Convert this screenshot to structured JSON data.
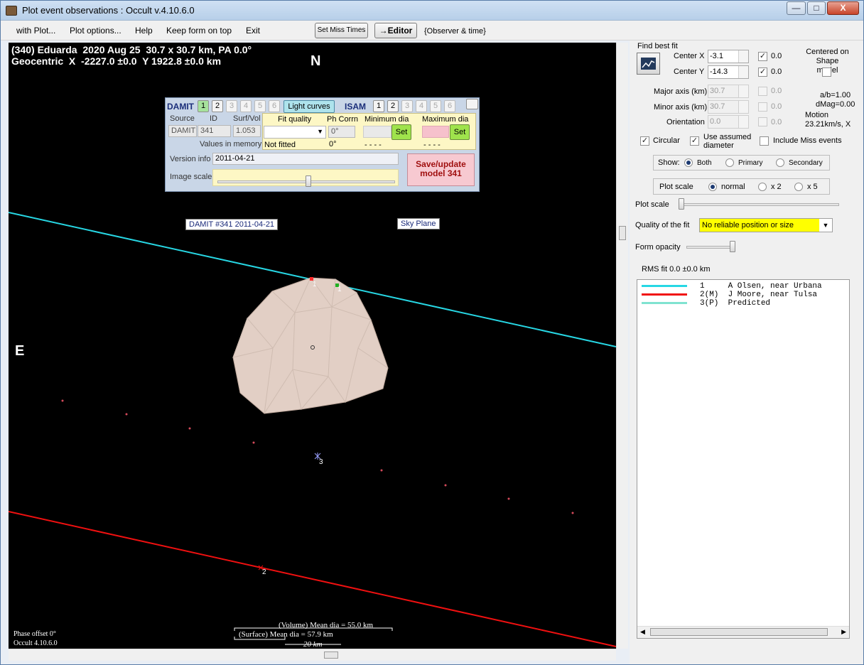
{
  "window": {
    "title": "Plot event observations : Occult v.4.10.6.0",
    "min_glyph": "—",
    "max_glyph": "□",
    "close_glyph": "X"
  },
  "menu": {
    "items": [
      "with Plot...",
      "Plot options...",
      "Help",
      "Keep form on top",
      "Exit"
    ],
    "set_miss_times": "Set Miss Times",
    "editor": "→Editor",
    "observer_time": "{Observer & time}"
  },
  "plot": {
    "header_line1": "(340) Eduarda  2020 Aug 25  30.7 x 30.7 km, PA 0.0°",
    "header_line2": "Geocentric  X  -2227.0 ±0.0  Y 1922.8 ±0.0 km",
    "north": "N",
    "east": "E",
    "model_label": "DAMIT #341 2011-04-21",
    "sky_plane_label": "Sky Plane",
    "chord_labels": [
      "1",
      "1",
      "2",
      "3"
    ],
    "volume_dia": "(Volume) Mean dia = 55.0 km",
    "surface_dia": "(Surface) Mean dia = 57.9 km",
    "scale_20km": "20 km",
    "phase_offset": "Phase offset 0°",
    "occult_version": "Occult 4.10.6.0",
    "colors": {
      "background": "#000000",
      "chord_1": "#27d7e4",
      "chord_2": "#f01010",
      "predicted": "#7fe3d0"
    }
  },
  "damit": {
    "title": "DAMIT",
    "buttons": [
      "1",
      "2",
      "3",
      "4",
      "5",
      "6"
    ],
    "light_curves": "Light curves",
    "isam_title": "ISAM",
    "isam_buttons": [
      "1",
      "2",
      "3",
      "4",
      "5",
      "6"
    ],
    "headers": {
      "source": "Source",
      "id": "ID",
      "surf_vol": "Surf/Vol",
      "fit_quality": "Fit quality",
      "ph_corrn": "Ph Corrn",
      "min_dia": "Minimum dia",
      "max_dia": "Maximum dia"
    },
    "source": "DAMIT",
    "id": "341",
    "surf_vol": "1.053",
    "ph_corrn": "0°",
    "ph_corrn2": "0°",
    "values_in_memory": "Values in memory =>",
    "not_fitted": "Not fitted",
    "dashes_min": "- - - -",
    "dashes_max": "- - - -",
    "set": "Set",
    "version_info_label": "Version info",
    "version_info": "2011-04-21",
    "image_scale_label": "Image scale",
    "save_update": "Save/update model 341"
  },
  "panel": {
    "find_best_fit": "Find best fit",
    "center_x_label": "Center X",
    "center_x": "-3.1",
    "center_x_fix": "0.0",
    "center_y_label": "Center Y",
    "center_y": "-14.3",
    "center_y_fix": "0.0",
    "centered_on": "Centered on Shape model",
    "major_axis_label": "Major axis (km)",
    "major_axis": "30.7",
    "major_fix": "0.0",
    "minor_axis_label": "Minor axis (km)",
    "minor_axis": "30.7",
    "minor_fix": "0.0",
    "orientation_label": "Orientation",
    "orientation": "0.0",
    "orientation_fix": "0.0",
    "ab_ratio": "a/b=1.00",
    "dmag": "dMag=0.00",
    "motion_label": "Motion",
    "motion": "23.21km/s, X",
    "circular": "Circular",
    "use_assumed": "Use assumed diameter",
    "include_miss": "Include Miss events",
    "show_label": "Show:",
    "show_both": "Both",
    "show_primary": "Primary",
    "show_secondary": "Secondary",
    "plot_scale_label": "Plot scale",
    "scale_normal": "normal",
    "scale_x2": "x 2",
    "scale_x5": "x 5",
    "plot_scale_slider_label": "Plot scale",
    "quality_label": "Quality of the fit",
    "quality_value": "No reliable position or size",
    "form_opacity": "Form opacity",
    "rms_fit": "RMS fit 0.0 ±0.0 km",
    "observers": [
      {
        "num": "1   ",
        "name": "A Olsen, near Urbana",
        "color": "#27d7e4"
      },
      {
        "num": "2(M)",
        "name": "J Moore, near Tulsa",
        "color": "#f01010"
      },
      {
        "num": "3(P)",
        "name": "Predicted",
        "color": "#7fe3d0"
      }
    ]
  }
}
